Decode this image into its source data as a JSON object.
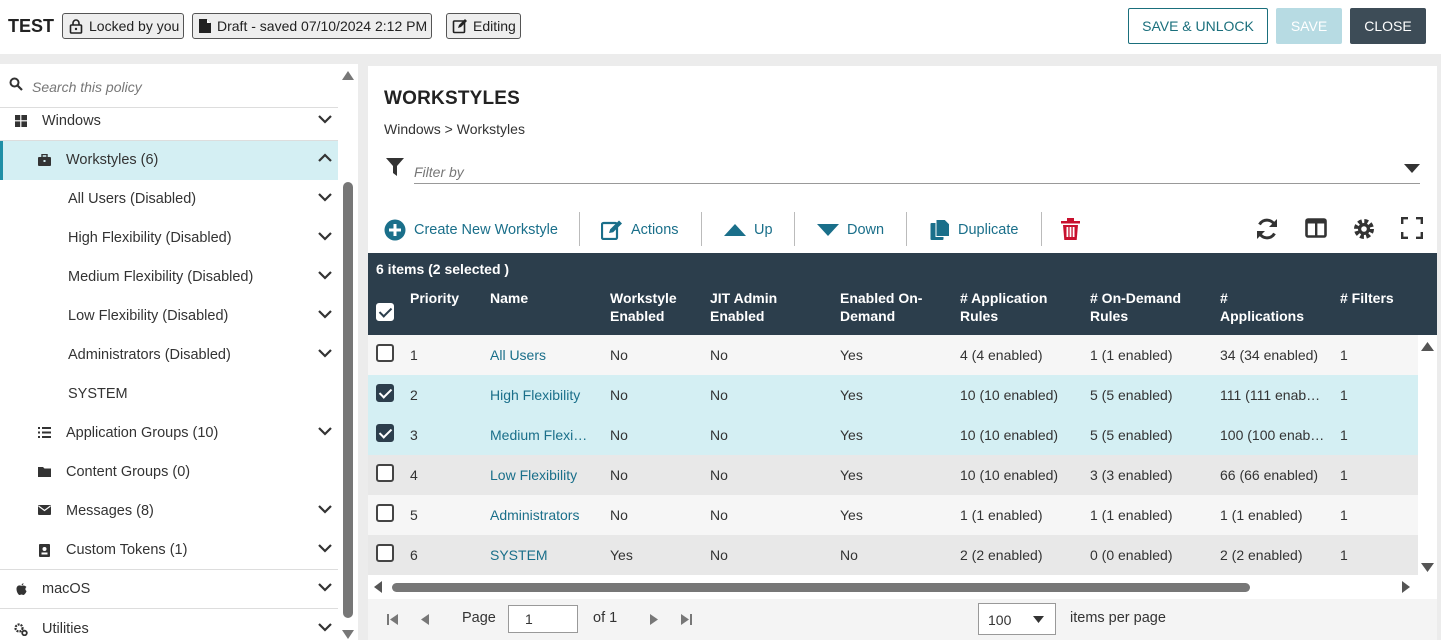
{
  "header": {
    "title": "TEST",
    "locked_label": "Locked by you",
    "draft_label": "Draft - saved 07/10/2024 2:12 PM",
    "editing_label": "Editing",
    "save_unlock_label": "SAVE & UNLOCK",
    "save_label": "SAVE",
    "close_label": "CLOSE"
  },
  "sidebar": {
    "search_placeholder": "Search this policy",
    "items": [
      {
        "label": "Windows",
        "icon": "windows-icon"
      },
      {
        "label": "Workstyles (6)",
        "icon": "briefcase-icon"
      },
      {
        "label": "All Users (Disabled)"
      },
      {
        "label": "High Flexibility (Disabled)"
      },
      {
        "label": "Medium Flexibility (Disabled)"
      },
      {
        "label": "Low Flexibility (Disabled)"
      },
      {
        "label": "Administrators (Disabled)"
      },
      {
        "label": "SYSTEM"
      },
      {
        "label": "Application Groups (10)",
        "icon": "list-icon"
      },
      {
        "label": "Content Groups (0)",
        "icon": "folder-icon"
      },
      {
        "label": "Messages (8)",
        "icon": "envelope-icon"
      },
      {
        "label": "Custom Tokens (1)",
        "icon": "token-icon"
      },
      {
        "label": "macOS",
        "icon": "apple-icon"
      },
      {
        "label": "Utilities",
        "icon": "gears-icon"
      }
    ]
  },
  "main": {
    "title": "WORKSTYLES",
    "breadcrumb": "Windows > Workstyles",
    "filter_placeholder": "Filter by",
    "toolbar": {
      "create_label": "Create New Workstyle",
      "actions_label": "Actions",
      "up_label": "Up",
      "down_label": "Down",
      "duplicate_label": "Duplicate"
    },
    "table": {
      "count_label": "6 items (2 selected )",
      "columns": [
        {
          "l1": "",
          "l2": "Priority"
        },
        {
          "l1": "",
          "l2": "Name"
        },
        {
          "l1": "Workstyle",
          "l2": "Enabled"
        },
        {
          "l1": "JIT Admin",
          "l2": "Enabled"
        },
        {
          "l1": "Enabled On-",
          "l2": "Demand"
        },
        {
          "l1": "# Application",
          "l2": "Rules"
        },
        {
          "l1": "# On-Demand",
          "l2": "Rules"
        },
        {
          "l1": "#",
          "l2": "Applications"
        },
        {
          "l1": "",
          "l2": "# Filters"
        }
      ],
      "rows": [
        {
          "checked": false,
          "priority": "1",
          "name": "All Users",
          "enabled": "No",
          "jit": "No",
          "on_demand": "Yes",
          "app_rules": "4 (4 enabled)",
          "od_rules": "1 (1 enabled)",
          "applications": "34 (34 enabled)",
          "filters": "1"
        },
        {
          "checked": true,
          "priority": "2",
          "name": "High Flexibility",
          "enabled": "No",
          "jit": "No",
          "on_demand": "Yes",
          "app_rules": "10 (10 enabled)",
          "od_rules": "5 (5 enabled)",
          "applications": "111 (111 enab…",
          "filters": "1"
        },
        {
          "checked": true,
          "priority": "3",
          "name": "Medium Flexi…",
          "enabled": "No",
          "jit": "No",
          "on_demand": "Yes",
          "app_rules": "10 (10 enabled)",
          "od_rules": "5 (5 enabled)",
          "applications": "100 (100 enab…",
          "filters": "1"
        },
        {
          "checked": false,
          "priority": "4",
          "name": "Low Flexibility",
          "enabled": "No",
          "jit": "No",
          "on_demand": "Yes",
          "app_rules": "10 (10 enabled)",
          "od_rules": "3 (3 enabled)",
          "applications": "66 (66 enabled)",
          "filters": "1"
        },
        {
          "checked": false,
          "priority": "5",
          "name": "Administrators",
          "enabled": "No",
          "jit": "No",
          "on_demand": "Yes",
          "app_rules": "1 (1 enabled)",
          "od_rules": "1 (1 enabled)",
          "applications": "1 (1 enabled)",
          "filters": "1"
        },
        {
          "checked": false,
          "priority": "6",
          "name": "SYSTEM",
          "enabled": "Yes",
          "jit": "No",
          "on_demand": "No",
          "app_rules": "2 (2 enabled)",
          "od_rules": "0 (0 enabled)",
          "applications": "2 (2 enabled)",
          "filters": "1"
        }
      ]
    },
    "pager": {
      "page_label": "Page",
      "page_value": "1",
      "of_label": "of 1",
      "per_page_value": "100",
      "per_page_label": "items per page"
    }
  },
  "colors": {
    "accent": "#1a6f8a",
    "header_dark": "#2c3e4c",
    "selected_row": "#d4eff3",
    "delete_red": "#c8102e"
  }
}
